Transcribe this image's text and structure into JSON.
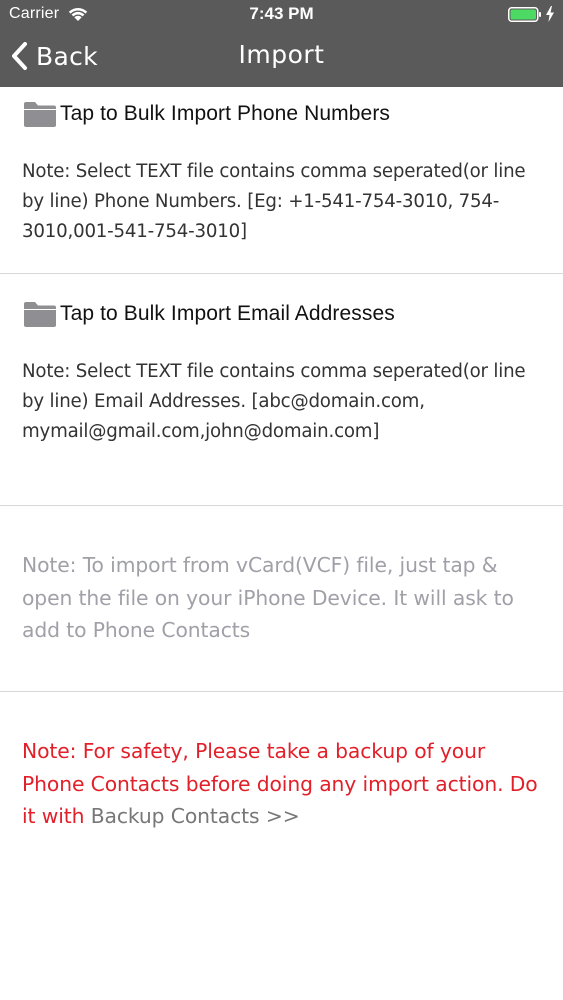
{
  "status_bar": {
    "carrier": "Carrier",
    "time": "7:43 PM",
    "battery_color": "#4cd964"
  },
  "nav": {
    "back_label": "Back",
    "title": "Import",
    "background": "#5a5a5a"
  },
  "phone_import": {
    "icon": "folder-icon",
    "label": "Tap to Bulk Import Phone Numbers",
    "note": "Note: Select TEXT file contains comma seperated(or line by line) Phone Numbers. [Eg: +1-541-754-3010, 754-3010,001-541-754-3010]"
  },
  "email_import": {
    "icon": "folder-icon",
    "label": "Tap to Bulk Import Email Addresses",
    "note": "Note: Select TEXT file contains comma seperated(or line by line) Email Addresses. [abc@domain.com, mymail@gmail.com,john@domain.com]"
  },
  "vcard_note": "Note: To import from vCard(VCF) file, just tap & open the file on your iPhone Device. It will ask to add to Phone Contacts",
  "safety_note": {
    "text": "Note: For safety, Please take a backup of your Phone Contacts before doing any import action. Do it with ",
    "link": "Backup Contacts >>",
    "color": "#e2202a"
  }
}
